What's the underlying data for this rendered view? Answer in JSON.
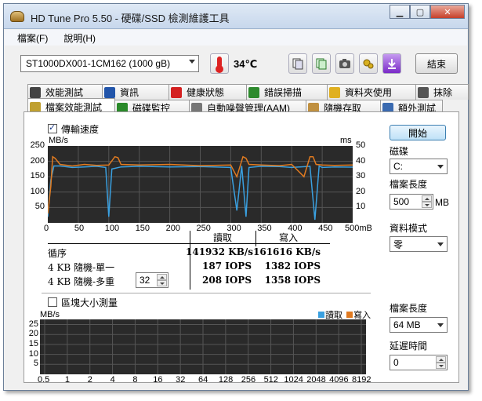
{
  "window": {
    "title": "HD Tune Pro 5.50 - 硬碟/SSD 檢測維護工具"
  },
  "menu": {
    "file": "檔案(F)",
    "help": "說明(H)"
  },
  "toolbar": {
    "drive": "ST1000DX001-1CM162 (1000 gB)",
    "temperature": "34℃",
    "exit_label": "結束"
  },
  "tabs_row1": [
    {
      "label": "效能測試",
      "icon": "gauge-icon",
      "color": "#444444"
    },
    {
      "label": "資訊",
      "icon": "info-icon",
      "color": "#2255aa"
    },
    {
      "label": "健康狀態",
      "icon": "health-cross-icon",
      "color": "#d42020"
    },
    {
      "label": "錯誤掃描",
      "icon": "magnifier-icon",
      "color": "#2d8a2d"
    },
    {
      "label": "資料夾使用",
      "icon": "folder-icon",
      "color": "#e0b020"
    },
    {
      "label": "抹除",
      "icon": "trash-icon",
      "color": "#555555"
    }
  ],
  "tabs_row2": [
    {
      "label": "檔案效能測試",
      "icon": "file-benchmark-icon",
      "color": "#c0a030"
    },
    {
      "label": "磁碟監控",
      "icon": "chart-icon",
      "color": "#2a8a2a"
    },
    {
      "label": "自動噪聲管理(AAM)",
      "icon": "speaker-icon",
      "color": "#777777"
    },
    {
      "label": "隨機存取",
      "icon": "grid-icon",
      "color": "#c09040"
    },
    {
      "label": "額外測試",
      "icon": "table-icon",
      "color": "#3a6ab0"
    }
  ],
  "transfer": {
    "checkbox_label": "傳輸速度",
    "y_unit_left": "MB/s",
    "y_unit_right": "ms",
    "y_ticks_left": [
      "250",
      "200",
      "150",
      "100",
      "50"
    ],
    "y_ticks_right": [
      "50",
      "40",
      "30",
      "20",
      "10"
    ],
    "x_ticks": [
      "0",
      "50",
      "100",
      "150",
      "200",
      "250",
      "300",
      "350",
      "400",
      "450",
      "500mB"
    ],
    "col_read": "讀取",
    "col_write": "寫入",
    "rows": [
      {
        "label": "循序",
        "read": "141932 KB/s",
        "write": "161616 KB/s"
      },
      {
        "label": "4 KB 隨機-單一",
        "read": "187 IOPS",
        "write": "1382 IOPS"
      },
      {
        "label": "4 KB 隨機-多重",
        "read": "208 IOPS",
        "write": "1358 IOPS"
      }
    ],
    "queue_depth": "32"
  },
  "block": {
    "checkbox_label": "區塊大小測量",
    "y_unit": "MB/s",
    "y_ticks": [
      "25",
      "20",
      "15",
      "10",
      "5"
    ],
    "x_ticks": [
      "0.5",
      "1",
      "2",
      "4",
      "8",
      "16",
      "32",
      "64",
      "128",
      "256",
      "512",
      "1024",
      "2048",
      "4096",
      "8192"
    ],
    "legend_read": "讀取",
    "legend_write": "寫入"
  },
  "side": {
    "start_label": "開始",
    "disk_label": "磁碟",
    "disk_value": "C:",
    "file_len_label": "檔案長度",
    "file_len_value": "500",
    "file_len_unit": "MB",
    "data_mode_label": "資料模式",
    "data_mode_value": "零",
    "file_len2_label": "檔案長度",
    "file_len2_value": "64 MB",
    "delay_label": "延遲時間",
    "delay_value": "0"
  },
  "colors": {
    "read": "#3aa0e0",
    "write": "#e07a20",
    "plot_bg": "#2a2a2a",
    "grid": "#555555"
  },
  "chart_data": {
    "type": "line",
    "x_range": [
      0,
      500
    ],
    "ylim_left": [
      0,
      250
    ],
    "ylim_right": [
      0,
      50
    ],
    "series": [
      {
        "name": "讀取",
        "x": [
          0,
          5,
          10,
          20,
          40,
          60,
          80,
          95,
          100,
          105,
          120,
          150,
          200,
          250,
          300,
          310,
          318,
          325,
          330,
          350,
          380,
          400,
          430,
          438,
          445,
          450,
          470,
          500
        ],
        "values": [
          20,
          140,
          185,
          185,
          180,
          182,
          184,
          180,
          20,
          175,
          182,
          184,
          182,
          183,
          180,
          40,
          185,
          20,
          180,
          184,
          183,
          180,
          184,
          10,
          185,
          180,
          182,
          181
        ]
      },
      {
        "name": "寫入",
        "x": [
          0,
          5,
          8,
          12,
          20,
          40,
          60,
          80,
          100,
          110,
          115,
          120,
          150,
          200,
          250,
          300,
          310,
          320,
          325,
          330,
          350,
          380,
          400,
          420,
          430,
          435,
          440,
          450,
          470,
          500
        ],
        "values": [
          30,
          120,
          215,
          210,
          190,
          185,
          190,
          187,
          188,
          215,
          212,
          190,
          188,
          190,
          186,
          188,
          150,
          215,
          210,
          190,
          188,
          186,
          190,
          150,
          215,
          215,
          190,
          188,
          187,
          188
        ]
      }
    ]
  }
}
